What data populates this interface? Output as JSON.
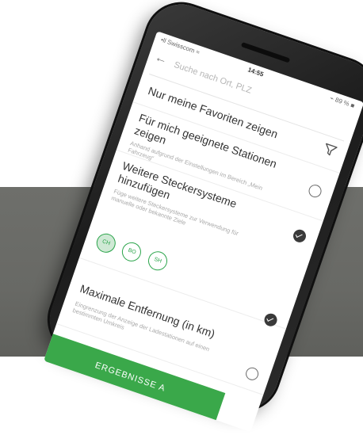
{
  "status_bar": {
    "carrier": "•ll Swisscom ≈",
    "time": "14:55",
    "battery": "⌁ 89 % ■"
  },
  "search": {
    "placeholder": "Suche nach Ort, PLZ"
  },
  "filters": [
    {
      "title": "Nur meine Favoriten zeigen",
      "subtitle": "",
      "checked": false
    },
    {
      "title": "Für mich geeignete Stationen zeigen",
      "subtitle": "Anhand aufgrund der Einstellungen im Bereich „Mein Fahrzeug“",
      "checked": false
    },
    {
      "title": "Weitere Steckersysteme hinzufügen",
      "subtitle": "Füge weitere Steckersysteme zur Verwendung für manuelle oder bekannte Ziele",
      "checked": true
    },
    {
      "title": "Maximale Entfernung (in km)",
      "subtitle": "Eingrenzung der Anzeige der Ladestationen auf einen bestimmten Umkreis",
      "checked": true
    }
  ],
  "connectors": [
    {
      "label": "CH",
      "selected": true
    },
    {
      "label": "BO",
      "selected": false
    },
    {
      "label": "SH",
      "selected": false
    }
  ],
  "results_button": {
    "label": "ERGEBNISSE A"
  },
  "colors": {
    "accent": "#3aa84a",
    "backdrop": "#6a6b67",
    "phone_body": "#222222"
  },
  "icons": {
    "back": "back-arrow-icon",
    "filter": "filter-funnel-icon"
  }
}
